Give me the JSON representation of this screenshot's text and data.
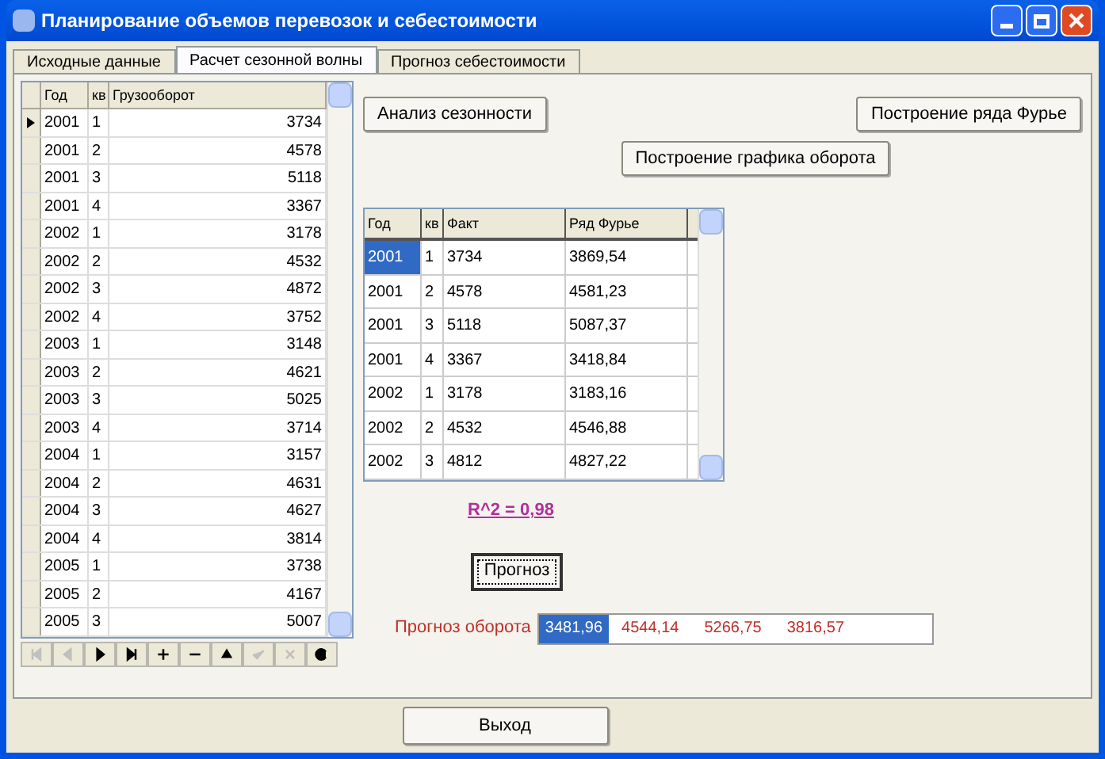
{
  "window": {
    "title": "Планирование объемов перевозок и себестоимости"
  },
  "tabs": [
    {
      "label": "Исходные данные",
      "selected": false
    },
    {
      "label": "Расчет сезонной волны",
      "selected": true
    },
    {
      "label": "Прогноз себестоимости",
      "selected": false
    }
  ],
  "left_table": {
    "columns": [
      "Год",
      "кв",
      "Грузооборот"
    ],
    "rows": [
      {
        "cells": [
          "2001",
          "1",
          "3734"
        ],
        "current": true
      },
      {
        "cells": [
          "2001",
          "2",
          "4578"
        ],
        "current": false
      },
      {
        "cells": [
          "2001",
          "3",
          "5118"
        ],
        "current": false
      },
      {
        "cells": [
          "2001",
          "4",
          "3367"
        ],
        "current": false
      },
      {
        "cells": [
          "2002",
          "1",
          "3178"
        ],
        "current": false
      },
      {
        "cells": [
          "2002",
          "2",
          "4532"
        ],
        "current": false
      },
      {
        "cells": [
          "2002",
          "3",
          "4872"
        ],
        "current": false
      },
      {
        "cells": [
          "2002",
          "4",
          "3752"
        ],
        "current": false
      },
      {
        "cells": [
          "2003",
          "1",
          "3148"
        ],
        "current": false
      },
      {
        "cells": [
          "2003",
          "2",
          "4621"
        ],
        "current": false
      },
      {
        "cells": [
          "2003",
          "3",
          "5025"
        ],
        "current": false
      },
      {
        "cells": [
          "2003",
          "4",
          "3714"
        ],
        "current": false
      },
      {
        "cells": [
          "2004",
          "1",
          "3157"
        ],
        "current": false
      },
      {
        "cells": [
          "2004",
          "2",
          "4631"
        ],
        "current": false
      },
      {
        "cells": [
          "2004",
          "3",
          "4627"
        ],
        "current": false
      },
      {
        "cells": [
          "2004",
          "4",
          "3814"
        ],
        "current": false
      },
      {
        "cells": [
          "2005",
          "1",
          "3738"
        ],
        "current": false
      },
      {
        "cells": [
          "2005",
          "2",
          "4167"
        ],
        "current": false
      },
      {
        "cells": [
          "2005",
          "3",
          "5007"
        ],
        "current": false
      }
    ]
  },
  "buttons_top": [
    "Анализ сезонности",
    "Построение ряда Фурье"
  ],
  "button_chart": "Построение графика оборота",
  "right_table": {
    "columns": [
      "Год",
      "кв",
      "Факт",
      "Ряд Фурье"
    ],
    "rows": [
      {
        "cells": [
          "2001",
          "1",
          "3734",
          "3869,54"
        ],
        "selected": true
      },
      {
        "cells": [
          "2001",
          "2",
          "4578",
          "4581,23"
        ],
        "selected": false
      },
      {
        "cells": [
          "2001",
          "3",
          "5118",
          "5087,37"
        ],
        "selected": false
      },
      {
        "cells": [
          "2001",
          "4",
          "3367",
          "3418,84"
        ],
        "selected": false
      },
      {
        "cells": [
          "2002",
          "1",
          "3178",
          "3183,16"
        ],
        "selected": false
      },
      {
        "cells": [
          "2002",
          "2",
          "4532",
          "4546,88"
        ],
        "selected": false
      },
      {
        "cells": [
          "2002",
          "3",
          "4812",
          "4827,22"
        ],
        "selected": false
      }
    ]
  },
  "r_squared": "R^2 = 0,98",
  "forecast_button": "Прогноз",
  "forecast": {
    "label": "Прогноз оборота",
    "values": [
      {
        "text": "3481,96",
        "selected": true
      },
      {
        "text": "4544,14",
        "selected": false
      },
      {
        "text": "5266,75",
        "selected": false
      },
      {
        "text": "3816,57",
        "selected": false
      }
    ]
  },
  "exit_button": "Выход"
}
